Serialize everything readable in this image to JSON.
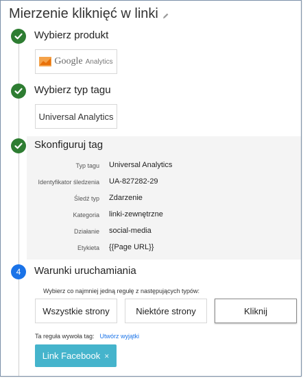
{
  "page": {
    "title": "Mierzenie kliknięć w linki"
  },
  "steps": [
    {
      "title": "Wybierz produkt",
      "status": "done"
    },
    {
      "title": "Wybierz typ tagu",
      "status": "done"
    },
    {
      "title": "Skonfiguruj tag",
      "status": "done"
    },
    {
      "title": "Warunki uruchamiania",
      "status": "active",
      "number": "4"
    }
  ],
  "product": {
    "logo_word": "Google",
    "logo_sub": "Analytics"
  },
  "tag_type": {
    "label": "Universal Analytics"
  },
  "config": {
    "rows": [
      {
        "label": "Typ tagu",
        "value": "Universal Analytics"
      },
      {
        "label": "Identyfikator śledzenia",
        "value": "UA-827282-29"
      },
      {
        "label": "Śledź typ",
        "value": "Zdarzenie"
      },
      {
        "label": "Kategoria",
        "value": "linki-zewnętrzne"
      },
      {
        "label": "Działanie",
        "value": "social-media"
      },
      {
        "label": "Etykieta",
        "value": "{{Page URL}}"
      }
    ]
  },
  "firing": {
    "hint": "Wybierz co najmniej jedną regułę z następujących typów:",
    "types": [
      "Wszystkie strony",
      "Niektóre strony",
      "Kliknij"
    ],
    "selected_index": 2,
    "rule_label": "Ta reguła wywoła tag:",
    "exception_link": "Utwórz wyjątki",
    "chip_label": "Link Facebook",
    "chip_remove": "×"
  },
  "colors": {
    "done": "#2e7d32",
    "active": "#1a73e8",
    "chip": "#45b4cc",
    "ga_logo": "#e8710a"
  }
}
